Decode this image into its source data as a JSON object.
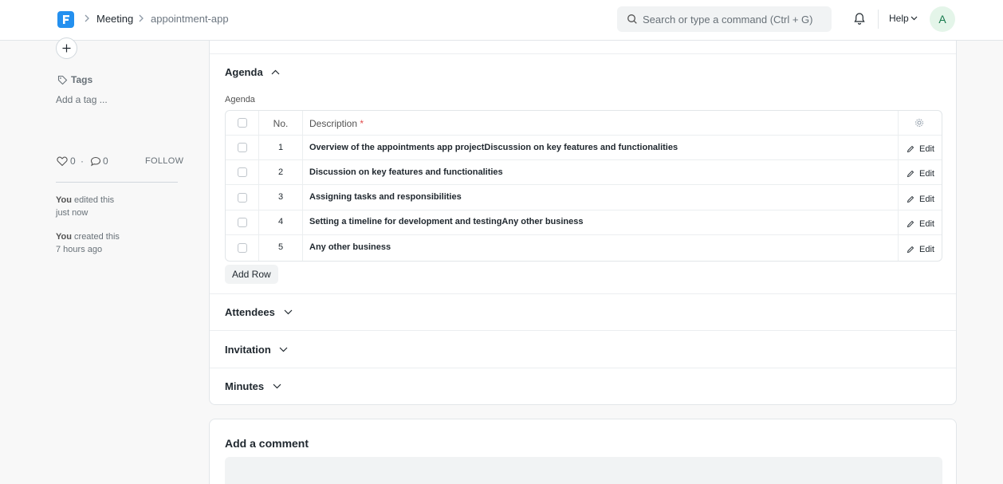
{
  "navbar": {
    "breadcrumbs": [
      "Meeting",
      "appointment-app"
    ],
    "search_placeholder": "Search or type a command (Ctrl + G)",
    "help_label": "Help",
    "avatar_initial": "A"
  },
  "sidebar": {
    "tags_label": "Tags",
    "add_tag": "Add a tag ...",
    "likes": "0",
    "dot": "·",
    "comments": "0",
    "follow": "FOLLOW",
    "activity": [
      {
        "who": "You",
        "action": "edited this",
        "when": "just now"
      },
      {
        "who": "You",
        "action": "created this",
        "when": "7 hours ago"
      }
    ]
  },
  "sections": {
    "agenda": "Agenda",
    "attendees": "Attendees",
    "invitation": "Invitation",
    "minutes": "Minutes"
  },
  "agenda_table": {
    "field_label": "Agenda",
    "header_no": "No.",
    "header_description": "Description",
    "required_mark": "*",
    "edit_label": "Edit",
    "rows": [
      {
        "no": "1",
        "description": "Overview of the appointments app projectDiscussion on key features and functionalities"
      },
      {
        "no": "2",
        "description": "Discussion on key features and functionalities"
      },
      {
        "no": "3",
        "description": "Assigning tasks and responsibilities"
      },
      {
        "no": "4",
        "description": "Setting a timeline for development and testingAny other business"
      },
      {
        "no": "5",
        "description": "Any other business"
      }
    ],
    "add_row": "Add Row"
  },
  "comment": {
    "title": "Add a comment"
  },
  "colors": {
    "accent": "#2490ef",
    "required": "#e24c4c",
    "avatar_bg": "#e4f5e9",
    "avatar_fg": "#16794c"
  }
}
